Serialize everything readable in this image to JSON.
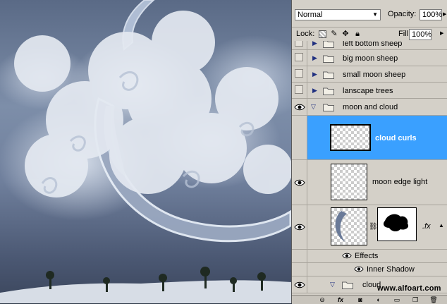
{
  "panel": {
    "blend_mode": "Normal",
    "opacity_label": "Opacity:",
    "opacity_value": "100%",
    "lock_label": "Lock:",
    "fill_label": "Fill:",
    "fill_value": "100%"
  },
  "layers": [
    {
      "name": "left bottom sheep",
      "type": "group",
      "visible": false,
      "expanded": false
    },
    {
      "name": "big moon sheep",
      "type": "group",
      "visible": false,
      "expanded": false
    },
    {
      "name": "small moon sheep",
      "type": "group",
      "visible": false,
      "expanded": false
    },
    {
      "name": "lanscape trees",
      "type": "group",
      "visible": false,
      "expanded": false
    },
    {
      "name": "moon and cloud",
      "type": "group",
      "visible": true,
      "expanded": true
    },
    {
      "name": "cloud curls",
      "type": "layer",
      "visible": false,
      "selected": true
    },
    {
      "name": "moon edge light",
      "type": "layer",
      "visible": true
    },
    {
      "name": "",
      "type": "layer-with-mask",
      "visible": true,
      "fx_label": ".fx"
    },
    {
      "name": "Effects",
      "type": "effects",
      "visible": true
    },
    {
      "name": "Inner Shadow",
      "type": "effect",
      "visible": true
    },
    {
      "name": "cloud",
      "type": "group",
      "visible": true,
      "expanded": true
    }
  ],
  "watermark": "www.alfoart.com",
  "colors": {
    "selection": "#3aa0ff",
    "panel_bg": "#d4d0c8"
  },
  "bottom_icons": [
    "link-icon",
    "fx-icon",
    "mask-icon",
    "adjustment-icon",
    "new-group-icon",
    "new-layer-icon",
    "trash-icon"
  ]
}
